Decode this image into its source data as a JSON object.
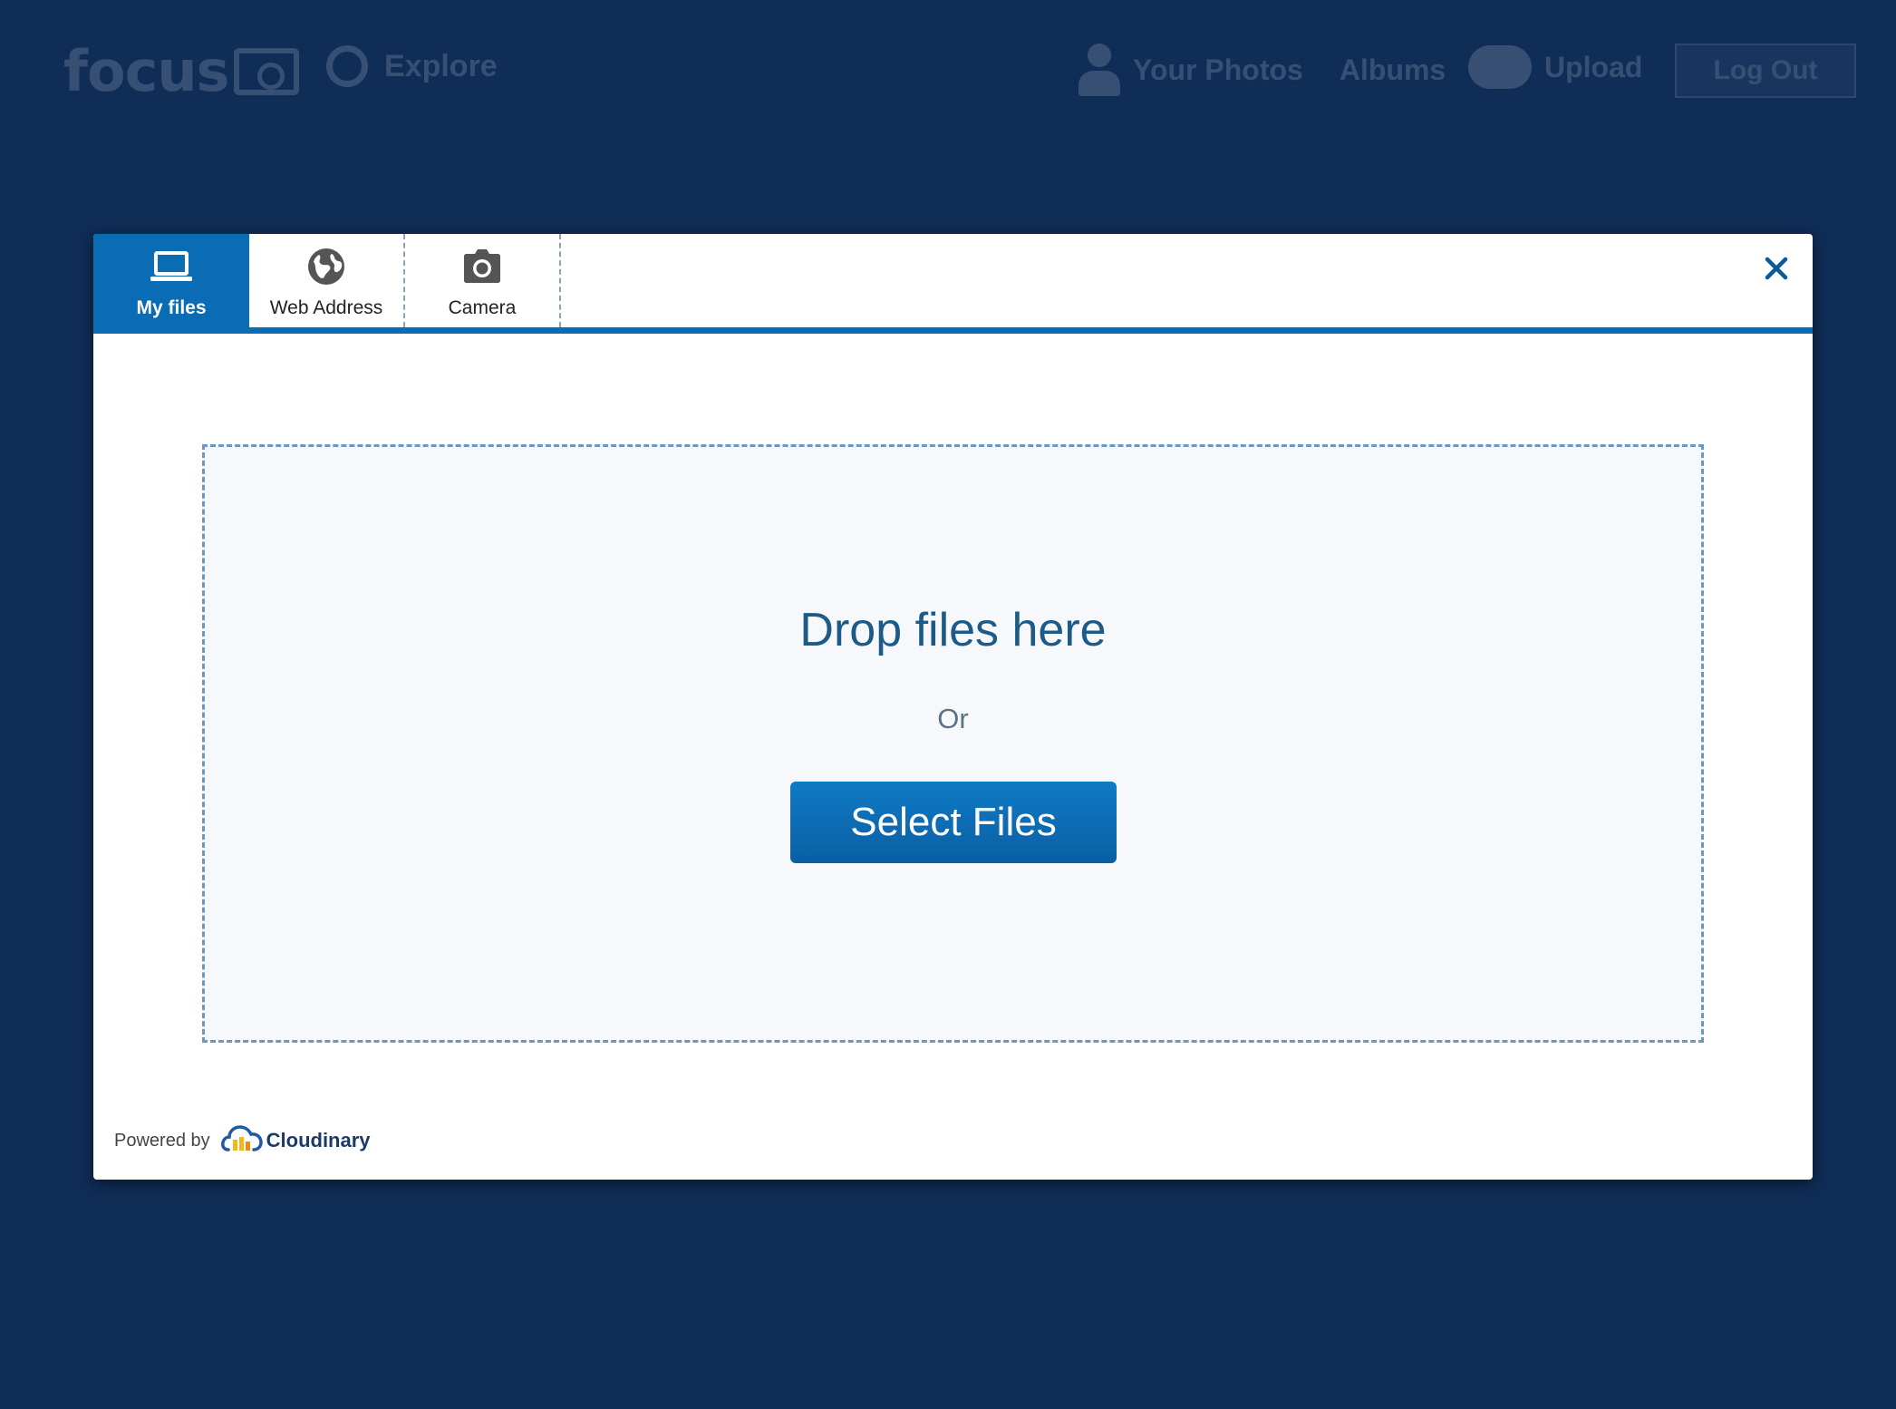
{
  "background": {
    "logo_text": "focus",
    "nav": {
      "explore": "Explore",
      "your_photos": "Your Photos",
      "albums": "Albums",
      "upload": "Upload",
      "log_out": "Log Out"
    }
  },
  "modal": {
    "tabs": [
      {
        "label": "My files",
        "icon": "laptop-icon",
        "active": true
      },
      {
        "label": "Web Address",
        "icon": "globe-icon",
        "active": false
      },
      {
        "label": "Camera",
        "icon": "camera-icon",
        "active": false
      }
    ],
    "close_icon": "close-icon",
    "drop_zone": {
      "title": "Drop files here",
      "or_text": "Or",
      "select_button": "Select Files"
    },
    "footer": {
      "powered_by": "Powered by",
      "brand": "Cloudinary"
    }
  },
  "colors": {
    "backdrop": "#102d58",
    "accent": "#0a6cb5",
    "drop_title": "#1c5a87",
    "drop_border": "#6c97bf",
    "brand_yellow": "#f5b81c",
    "brand_orange": "#ef8a1a"
  }
}
